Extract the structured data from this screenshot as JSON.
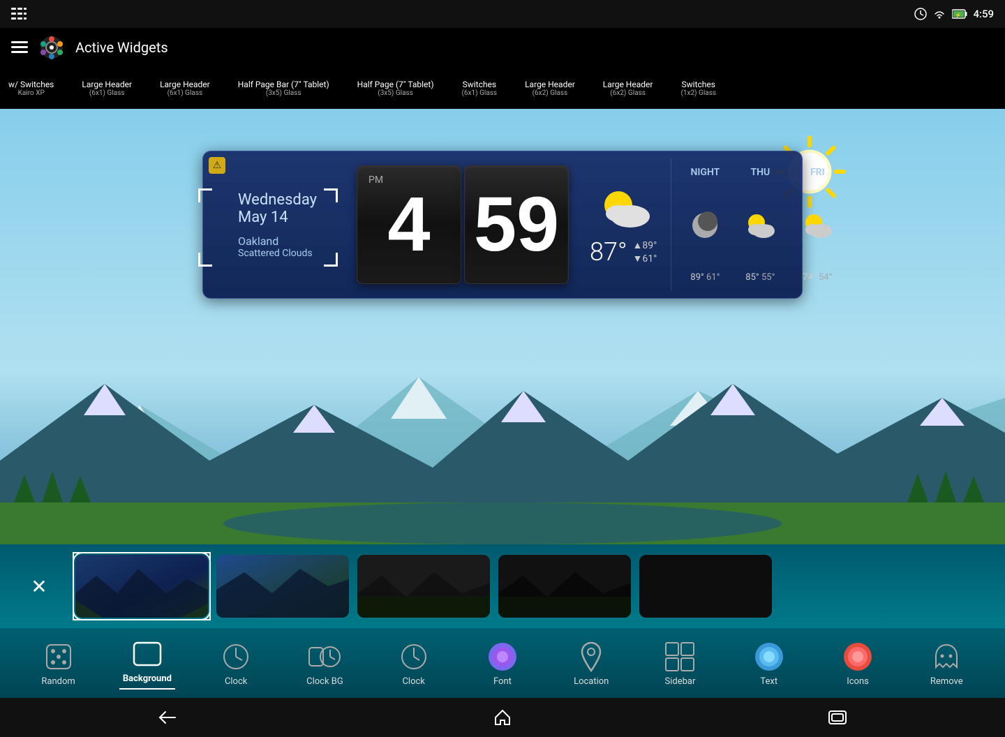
{
  "statusBar": {
    "time": "4:59",
    "icons": [
      "hamburger-menu",
      "clock-icon",
      "wifi-icon",
      "battery-icon"
    ]
  },
  "appBar": {
    "title": "Active Widgets",
    "menuIcon": "menu-icon",
    "logoIcon": "logo-icon"
  },
  "widgetsStrip": {
    "items": [
      {
        "name": "w/ Switches",
        "desc": "Kairo XP"
      },
      {
        "name": "Large Header",
        "desc": "(6x1) Glass"
      },
      {
        "name": "Large Header",
        "desc": "(6x1) Glass"
      },
      {
        "name": "Half Page Bar (7\" Tablet)",
        "desc": "(3x5) Glass"
      },
      {
        "name": "Half Page (7\" Tablet)",
        "desc": "(3x5) Glass"
      },
      {
        "name": "Switches",
        "desc": "(6x1) Glass"
      },
      {
        "name": "Large Header",
        "desc": "(6x2) Glass"
      },
      {
        "name": "Large Header",
        "desc": "(6x2) Glass"
      },
      {
        "name": "Switches",
        "desc": "(1x2) Glass"
      }
    ]
  },
  "weatherWidget": {
    "dayOfWeek": "Wednesday",
    "date": "May 14",
    "city": "Oakland",
    "condition": "Scattered Clouds",
    "hour": "4",
    "minute": "59",
    "ampm": "PM",
    "currentTemp": "87°",
    "highTemp": "▲89°",
    "lowTemp": "▼61°",
    "forecast": [
      {
        "day": "NIGHT",
        "icon": "moon",
        "high": "89°",
        "low": "61°"
      },
      {
        "day": "THU",
        "icon": "partly-cloudy",
        "high": "85°",
        "low": "55°"
      },
      {
        "day": "FRI",
        "icon": "partly-cloudy",
        "high": "74°",
        "low": "54°"
      }
    ]
  },
  "themeSelector": {
    "themes": [
      {
        "id": "theme1",
        "style": "tc-blue-dark",
        "selected": true
      },
      {
        "id": "theme2",
        "style": "tc-blue-medium",
        "selected": false
      },
      {
        "id": "theme3",
        "style": "tc-dark",
        "selected": false
      },
      {
        "id": "theme4",
        "style": "tc-dark2",
        "selected": false
      },
      {
        "id": "theme5",
        "style": "tc-dark3",
        "selected": false
      }
    ]
  },
  "toolbar": {
    "items": [
      {
        "id": "random",
        "label": "Random",
        "icon": "🎲",
        "active": false
      },
      {
        "id": "background",
        "label": "Background",
        "icon": "⬜",
        "active": true
      },
      {
        "id": "clock",
        "label": "Clock",
        "icon": "🕐",
        "active": false
      },
      {
        "id": "clock-bg",
        "label": "Clock BG",
        "icon": "🕐",
        "active": false
      },
      {
        "id": "clock2",
        "label": "Clock",
        "icon": "🕐",
        "active": false
      },
      {
        "id": "font",
        "label": "Font",
        "icon": "🔵",
        "active": false
      },
      {
        "id": "location",
        "label": "Location",
        "icon": "📍",
        "active": false
      },
      {
        "id": "sidebar",
        "label": "Sidebar",
        "icon": "⊞",
        "active": false
      },
      {
        "id": "text",
        "label": "Text",
        "icon": "🔵",
        "active": false
      },
      {
        "id": "icons",
        "label": "Icons",
        "icon": "🔵",
        "active": false
      },
      {
        "id": "remove",
        "label": "Remove",
        "icon": "👻",
        "active": false
      }
    ]
  },
  "navBar": {
    "back": "←",
    "home": "⌂",
    "recent": "▭"
  }
}
